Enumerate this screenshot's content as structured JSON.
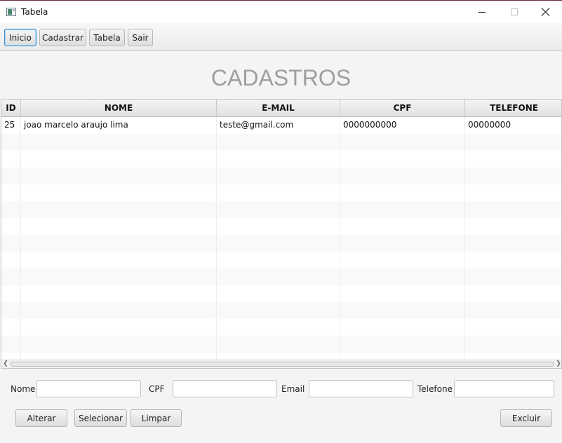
{
  "window": {
    "title": "Tabela"
  },
  "toolbar": {
    "buttons": [
      "Inicio",
      "Cadastrar",
      "Tabela",
      "Sair"
    ],
    "active": "Inicio"
  },
  "heading": "CADASTROS",
  "table": {
    "columns": [
      "ID",
      "NOME",
      "E-MAIL",
      "CPF",
      "TELEFONE"
    ],
    "rows": [
      [
        "25",
        "joao marcelo araujo lima",
        "teste@gmail.com",
        "0000000000",
        "00000000"
      ]
    ]
  },
  "form": {
    "nome_label": "Nome",
    "cpf_label": "CPF",
    "email_label": "Email",
    "telefone_label": "Telefone",
    "nome_value": "",
    "cpf_value": "",
    "email_value": "",
    "telefone_value": ""
  },
  "actions": {
    "alterar": "Alterar",
    "selecionar": "Selecionar",
    "limpar": "Limpar",
    "excluir": "Excluir"
  },
  "colors": {
    "focus_border": "#3d8fd0",
    "heading_text": "#9e9e9e",
    "window_accent": "#6b2a3a"
  }
}
